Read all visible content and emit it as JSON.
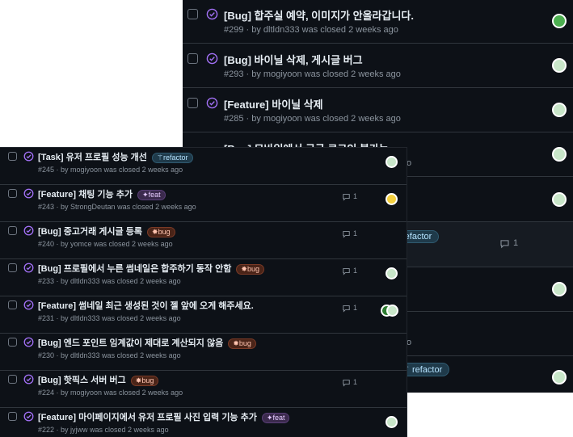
{
  "back_issues": [
    {
      "title": "[Bug] 합주실 예약, 이미지가 안올라갑니다.",
      "meta": "#299 · by dltldn333 was closed 2 weeks ago"
    },
    {
      "title": "[Bug] 바이닐 삭제, 게시글 버그",
      "meta": "#293 · by mogiyoon was closed 2 weeks ago"
    },
    {
      "title": "[Feature] 바이닐 삭제",
      "meta": "#285 · by mogiyoon was closed 2 weeks ago"
    },
    {
      "title": "[Bug] 모바일에서 구글 로그인 불가능",
      "meta": "o"
    },
    {
      "title": "",
      "meta": ""
    },
    {
      "label": "refactor",
      "comments": "1"
    },
    {
      "title": "",
      "meta": ""
    },
    {
      "meta": "o"
    },
    {
      "label": "refactor"
    }
  ],
  "front_issues": [
    {
      "title": "[Task] 유저 프로필 성능 개선",
      "label": "refactor",
      "meta": "#245 · by mogiyoon was closed 2 weeks ago",
      "comments": ""
    },
    {
      "title": "[Feature] 채팅 기능 추가",
      "label": "feat",
      "meta": "#243 · by StrongDeutan was closed 2 weeks ago",
      "comments": "1"
    },
    {
      "title": "[Bug] 중고거래 게시글 등록",
      "label": "bug",
      "meta": "#240 · by yomce was closed 2 weeks ago",
      "comments": "1"
    },
    {
      "title": "[Bug] 프로필에서 누른 썸네일은 합주하기 동작 안함",
      "label": "bug",
      "meta": "#233 · by dltldn333 was closed 2 weeks ago",
      "comments": "1"
    },
    {
      "title": "[Feature] 썸네일 최근 생성된 것이 젤 앞에 오게 해주세요.",
      "label": "",
      "meta": "#231 · by dltldn333 was closed 2 weeks ago",
      "comments": "1"
    },
    {
      "title": "[Bug] 엔드 포인트 임계값이 제대로 계산되지 않음",
      "label": "bug",
      "meta": "#230 · by dltldn333 was closed 2 weeks ago",
      "comments": ""
    },
    {
      "title": "[Bug] 핫픽스 서버 버그",
      "label": "bug",
      "meta": "#224 · by mogiyoon was closed 2 weeks ago",
      "comments": "1"
    },
    {
      "title": "[Feature] 마이페이지에서 유저 프로필 사진 입력 기능 추가",
      "label": "feat",
      "meta": "#222 · by jyjww was closed 2 weeks ago",
      "comments": ""
    }
  ],
  "icons": {
    "closed": "check-circle-icon",
    "comment": "comment-icon",
    "label_refactor": "wand-icon",
    "label_feat": "sparkle-icon",
    "label_bug": "bug-icon"
  },
  "colors": {
    "closed_purple": "#a371f7",
    "bg": "#0d1117",
    "border": "#30363d",
    "text": "#e6edf3",
    "muted": "#8b949e"
  }
}
